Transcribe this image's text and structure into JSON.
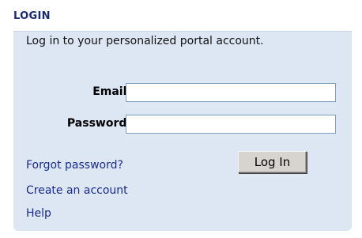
{
  "header": {
    "title": "LOGIN"
  },
  "login_panel": {
    "intro": "Log in to your personalized portal account.",
    "email_label": "Email:",
    "email_value": "",
    "password_label": "Password:",
    "password_value": "",
    "submit_label": "Log In",
    "links": {
      "forgot_password": "Forgot password?",
      "create_account": "Create an account",
      "help": "Help"
    }
  },
  "colors": {
    "title": "#1a2a6e",
    "panel_background": "#dde7f3",
    "link": "#1a2a8a",
    "field_border": "#7f9db9"
  }
}
